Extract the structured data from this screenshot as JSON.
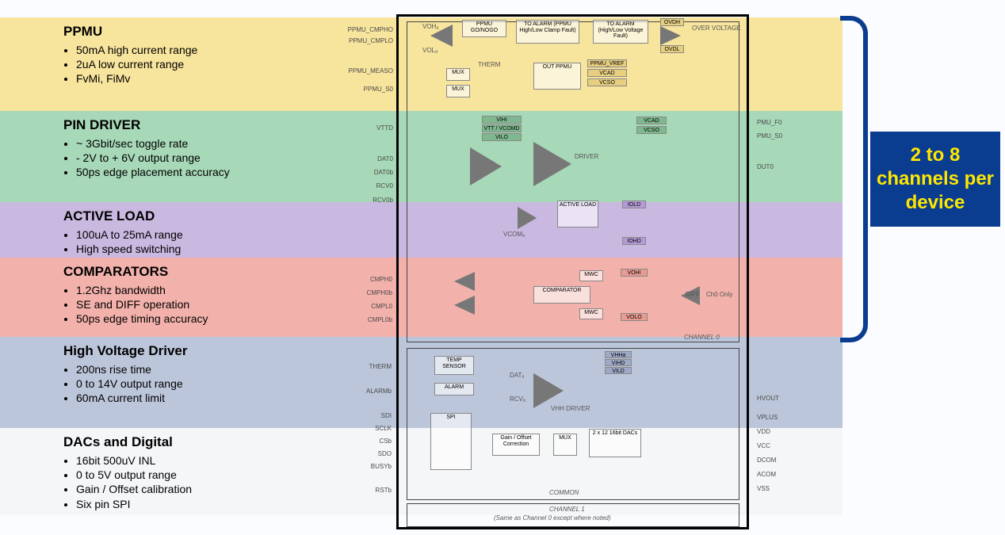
{
  "callout": {
    "text": "2 to 8 channels per device"
  },
  "sections": {
    "ppmu": {
      "title": "PPMU",
      "bullets": [
        "50mA high current range",
        "2uA low current range",
        "FvMi, FiMv"
      ]
    },
    "driver": {
      "title": "PIN DRIVER",
      "bullets": [
        "~ 3Gbit/sec toggle rate",
        "- 2V to + 6V output range",
        "50ps edge placement accuracy"
      ]
    },
    "load": {
      "title": "ACTIVE LOAD",
      "bullets": [
        "100uA to 25mA range",
        "High speed switching"
      ]
    },
    "comp": {
      "title": "COMPARATORS",
      "bullets": [
        "1.2Ghz bandwidth",
        "SE and DIFF operation",
        "50ps edge timing accuracy"
      ]
    },
    "hv": {
      "title": "High Voltage Driver",
      "bullets": [
        "200ns rise time",
        "0 to 14V output range",
        "60mA current limit"
      ]
    },
    "dac": {
      "title": "DACs and Digital",
      "bullets": [
        "16bit 500uV INL",
        "0 to 5V output range",
        "Gain / Offset calibration",
        "Six pin SPI"
      ]
    }
  },
  "diagram_labels": {
    "ppmu_top": "PPMU GO/NOGO",
    "alarm1": "TO ALARM (PPMU High/Low Clamp Fault)",
    "alarm2": "TO ALARM (High/Low Voltage Fault)",
    "overv": "OVER VOLTAGE",
    "out_ppmu": "OUT PPMU",
    "therm": "THERM",
    "mux": "MUX",
    "voh": "VOHₐ",
    "vol": "VOLₐ",
    "ovdh": "OVDH",
    "ovdl": "OVDL",
    "ppmu_vref": "PPMU_VREF",
    "vcad": "VCAD",
    "vcso": "VCSO",
    "driver": "DRIVER",
    "active_load": "ACTIVE LOAD",
    "vcom": "VCOMₐ",
    "comparator": "COMPARATOR",
    "mwc": "MWC",
    "diff": "DIFF",
    "ch0only": "Ch0 Only",
    "vihi": "VIHI",
    "vtt_vcomd": "VTT / VCOMD",
    "vilo": "VILO",
    "vcad2": "VCAD",
    "vcso2": "VCSO",
    "iold": "IOLD",
    "iohd": "IOHD",
    "vohi": "VOHI",
    "volo": "VOLO",
    "temp_sensor": "TEMP SENSOR",
    "alarm_box": "ALARM",
    "spi": "SPI",
    "gain_offset": "Gain / Offset Correction",
    "mux2": "MUX",
    "dac": "2 x 12 16bit DACs",
    "vhh_driver": "VHH DRIVER",
    "dat": "DATₐ",
    "rcv": "RCVₐ",
    "vhha": "VHHa",
    "vihd": "VIHD",
    "vild": "VILD",
    "channel0": "CHANNEL 0",
    "common": "COMMON",
    "channel1": "CHANNEL 1",
    "channel1_note": "(Same as Channel 0 except where noted)"
  },
  "pins": {
    "left_ppmu": [
      "PPMU_CMPHO",
      "PPMU_CMPLO",
      "PPMU_MEASO",
      "PPMU_S0"
    ],
    "left_driver": [
      "VTTD",
      "DAT0",
      "DAT0b",
      "RCV0",
      "RCV0b"
    ],
    "left_comp": [
      "CMPH0",
      "CMPH0b",
      "CMPL0",
      "CMPL0b"
    ],
    "left_hv": [
      "THERM",
      "ALARMb",
      "SDI",
      "SCLK",
      "CSb",
      "SDO",
      "BUSYb",
      "RSTb"
    ],
    "right_driver": [
      "PMU_F0",
      "PMU_S0",
      "DUT0"
    ],
    "right_dac": [
      "HVOUT",
      "VPLUS",
      "VDD",
      "VCC",
      "DCOM",
      "ACOM",
      "VSS"
    ]
  },
  "colors": {
    "ppmu": "#f7e49d",
    "driver": "#a7d8b8",
    "load": "#c9b8e0",
    "comp": "#f2b1ab",
    "hv": "#bcc6da",
    "dac": "#f5f6f8",
    "callout_bg": "#0a3d8f",
    "callout_text": "#ffe600"
  }
}
